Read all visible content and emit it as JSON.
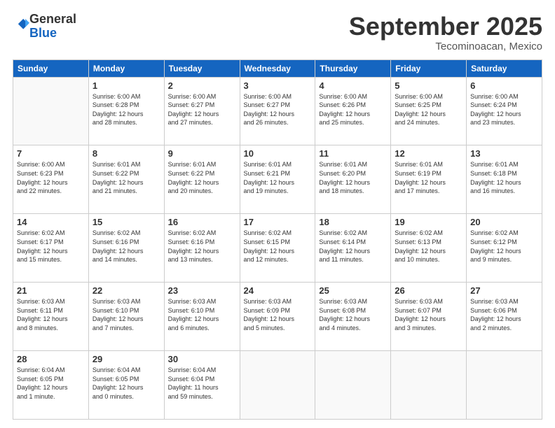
{
  "header": {
    "logo_general": "General",
    "logo_blue": "Blue",
    "month_title": "September 2025",
    "location": "Tecominoacan, Mexico"
  },
  "days_of_week": [
    "Sunday",
    "Monday",
    "Tuesday",
    "Wednesday",
    "Thursday",
    "Friday",
    "Saturday"
  ],
  "weeks": [
    [
      {
        "day": "",
        "info": ""
      },
      {
        "day": "1",
        "info": "Sunrise: 6:00 AM\nSunset: 6:28 PM\nDaylight: 12 hours\nand 28 minutes."
      },
      {
        "day": "2",
        "info": "Sunrise: 6:00 AM\nSunset: 6:27 PM\nDaylight: 12 hours\nand 27 minutes."
      },
      {
        "day": "3",
        "info": "Sunrise: 6:00 AM\nSunset: 6:27 PM\nDaylight: 12 hours\nand 26 minutes."
      },
      {
        "day": "4",
        "info": "Sunrise: 6:00 AM\nSunset: 6:26 PM\nDaylight: 12 hours\nand 25 minutes."
      },
      {
        "day": "5",
        "info": "Sunrise: 6:00 AM\nSunset: 6:25 PM\nDaylight: 12 hours\nand 24 minutes."
      },
      {
        "day": "6",
        "info": "Sunrise: 6:00 AM\nSunset: 6:24 PM\nDaylight: 12 hours\nand 23 minutes."
      }
    ],
    [
      {
        "day": "7",
        "info": "Sunrise: 6:00 AM\nSunset: 6:23 PM\nDaylight: 12 hours\nand 22 minutes."
      },
      {
        "day": "8",
        "info": "Sunrise: 6:01 AM\nSunset: 6:22 PM\nDaylight: 12 hours\nand 21 minutes."
      },
      {
        "day": "9",
        "info": "Sunrise: 6:01 AM\nSunset: 6:22 PM\nDaylight: 12 hours\nand 20 minutes."
      },
      {
        "day": "10",
        "info": "Sunrise: 6:01 AM\nSunset: 6:21 PM\nDaylight: 12 hours\nand 19 minutes."
      },
      {
        "day": "11",
        "info": "Sunrise: 6:01 AM\nSunset: 6:20 PM\nDaylight: 12 hours\nand 18 minutes."
      },
      {
        "day": "12",
        "info": "Sunrise: 6:01 AM\nSunset: 6:19 PM\nDaylight: 12 hours\nand 17 minutes."
      },
      {
        "day": "13",
        "info": "Sunrise: 6:01 AM\nSunset: 6:18 PM\nDaylight: 12 hours\nand 16 minutes."
      }
    ],
    [
      {
        "day": "14",
        "info": "Sunrise: 6:02 AM\nSunset: 6:17 PM\nDaylight: 12 hours\nand 15 minutes."
      },
      {
        "day": "15",
        "info": "Sunrise: 6:02 AM\nSunset: 6:16 PM\nDaylight: 12 hours\nand 14 minutes."
      },
      {
        "day": "16",
        "info": "Sunrise: 6:02 AM\nSunset: 6:16 PM\nDaylight: 12 hours\nand 13 minutes."
      },
      {
        "day": "17",
        "info": "Sunrise: 6:02 AM\nSunset: 6:15 PM\nDaylight: 12 hours\nand 12 minutes."
      },
      {
        "day": "18",
        "info": "Sunrise: 6:02 AM\nSunset: 6:14 PM\nDaylight: 12 hours\nand 11 minutes."
      },
      {
        "day": "19",
        "info": "Sunrise: 6:02 AM\nSunset: 6:13 PM\nDaylight: 12 hours\nand 10 minutes."
      },
      {
        "day": "20",
        "info": "Sunrise: 6:02 AM\nSunset: 6:12 PM\nDaylight: 12 hours\nand 9 minutes."
      }
    ],
    [
      {
        "day": "21",
        "info": "Sunrise: 6:03 AM\nSunset: 6:11 PM\nDaylight: 12 hours\nand 8 minutes."
      },
      {
        "day": "22",
        "info": "Sunrise: 6:03 AM\nSunset: 6:10 PM\nDaylight: 12 hours\nand 7 minutes."
      },
      {
        "day": "23",
        "info": "Sunrise: 6:03 AM\nSunset: 6:10 PM\nDaylight: 12 hours\nand 6 minutes."
      },
      {
        "day": "24",
        "info": "Sunrise: 6:03 AM\nSunset: 6:09 PM\nDaylight: 12 hours\nand 5 minutes."
      },
      {
        "day": "25",
        "info": "Sunrise: 6:03 AM\nSunset: 6:08 PM\nDaylight: 12 hours\nand 4 minutes."
      },
      {
        "day": "26",
        "info": "Sunrise: 6:03 AM\nSunset: 6:07 PM\nDaylight: 12 hours\nand 3 minutes."
      },
      {
        "day": "27",
        "info": "Sunrise: 6:03 AM\nSunset: 6:06 PM\nDaylight: 12 hours\nand 2 minutes."
      }
    ],
    [
      {
        "day": "28",
        "info": "Sunrise: 6:04 AM\nSunset: 6:05 PM\nDaylight: 12 hours\nand 1 minute."
      },
      {
        "day": "29",
        "info": "Sunrise: 6:04 AM\nSunset: 6:05 PM\nDaylight: 12 hours\nand 0 minutes."
      },
      {
        "day": "30",
        "info": "Sunrise: 6:04 AM\nSunset: 6:04 PM\nDaylight: 11 hours\nand 59 minutes."
      },
      {
        "day": "",
        "info": ""
      },
      {
        "day": "",
        "info": ""
      },
      {
        "day": "",
        "info": ""
      },
      {
        "day": "",
        "info": ""
      }
    ]
  ]
}
